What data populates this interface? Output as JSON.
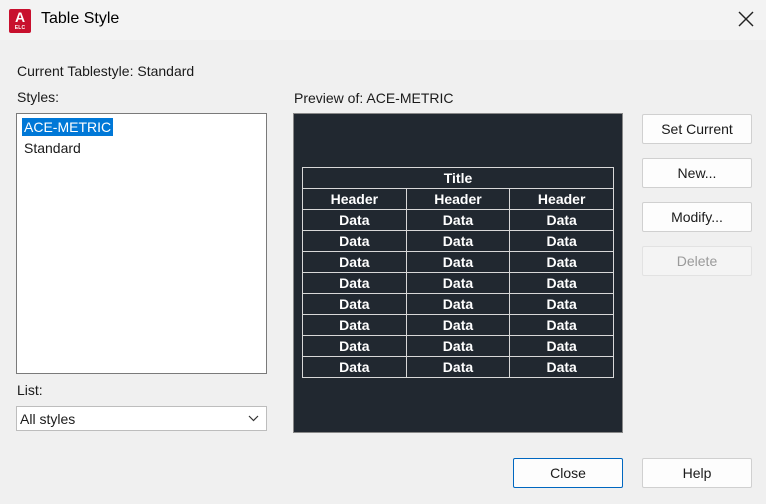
{
  "window": {
    "title": "Table Style",
    "app_icon_letter": "A",
    "app_icon_sub": "ELC"
  },
  "current_tablestyle": "Current Tablestyle: Standard",
  "styles": {
    "label": "Styles:",
    "items": [
      "ACE-METRIC",
      "Standard"
    ],
    "selected": "ACE-METRIC"
  },
  "list": {
    "label": "List:",
    "selected": "All styles"
  },
  "preview": {
    "label": "Preview of: ACE-METRIC",
    "table": {
      "title": "Title",
      "headers": [
        "Header",
        "Header",
        "Header"
      ],
      "rows": [
        [
          "Data",
          "Data",
          "Data"
        ],
        [
          "Data",
          "Data",
          "Data"
        ],
        [
          "Data",
          "Data",
          "Data"
        ],
        [
          "Data",
          "Data",
          "Data"
        ],
        [
          "Data",
          "Data",
          "Data"
        ],
        [
          "Data",
          "Data",
          "Data"
        ],
        [
          "Data",
          "Data",
          "Data"
        ],
        [
          "Data",
          "Data",
          "Data"
        ]
      ]
    }
  },
  "buttons": {
    "set_current": "Set Current",
    "new": "New...",
    "modify": "Modify...",
    "delete": "Delete",
    "close": "Close",
    "help": "Help"
  },
  "colors": {
    "selection": "#0078d7",
    "preview_background": "#212830",
    "app_icon": "#c8102e"
  }
}
